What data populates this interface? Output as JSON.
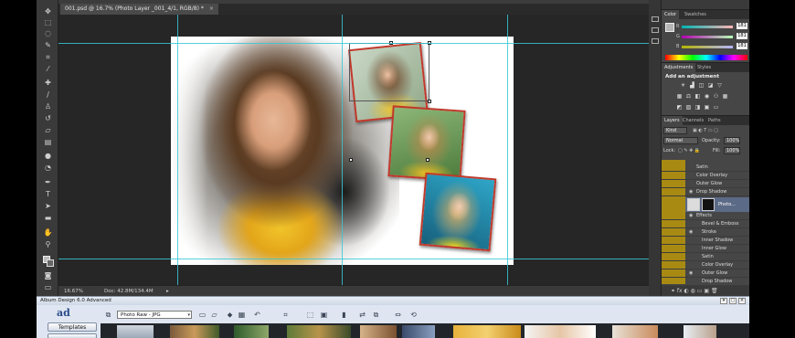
{
  "document": {
    "tab_title": "001.psd @ 16.7% (Photo Layer _001_4/1, RGB/8) *",
    "close_symbol": "×"
  },
  "status": {
    "zoom": "16.67%",
    "doc_size": "Doc: 42.8M/134.4M",
    "arrow": "▸"
  },
  "color_panel": {
    "tabs": [
      "Color",
      "Swatches"
    ],
    "values": [
      {
        "channel": "R",
        "value": "181"
      },
      {
        "channel": "G",
        "value": "181"
      },
      {
        "channel": "B",
        "value": "181"
      }
    ]
  },
  "adjustments_panel": {
    "tabs": [
      "Adjustments",
      "Styles"
    ],
    "heading": "Add an adjustment"
  },
  "layers_panel": {
    "tabs": [
      "Layers",
      "Channels",
      "Paths"
    ],
    "filter": "Kind",
    "blend_mode": "Normal",
    "opacity_label": "Opacity:",
    "opacity_value": "100%",
    "lock_label": "Lock:",
    "fill_label": "Fill:",
    "fill_value": "100%",
    "rows_top": [
      "Satin",
      "Color Overlay",
      "Outer Glow",
      "Drop Shadow"
    ],
    "selected_layer": "Photo...",
    "effects_label": "Effects",
    "rows_bottom": [
      "Bevel & Emboss",
      "Stroke",
      "Inner Shadow",
      "Inner Glow",
      "Satin",
      "Color Overlay",
      "Outer Glow",
      "Drop Shadow"
    ],
    "bottom_icons": "⚭  fx  ◐  ◍  ▭  ▣  🗑"
  },
  "album": {
    "title": "Album Design 6.0 Advanced",
    "logo": "ad",
    "buttons": [
      "Templates"
    ],
    "source_select": "Photo Raw - JPG",
    "controls": [
      "▾",
      "▢",
      "×"
    ]
  },
  "colors": {
    "guide": "#38c8d4",
    "photo_frame": "#c0392b",
    "layer_highlight": "#5b6a86",
    "olive_strip": "#a88a12"
  }
}
